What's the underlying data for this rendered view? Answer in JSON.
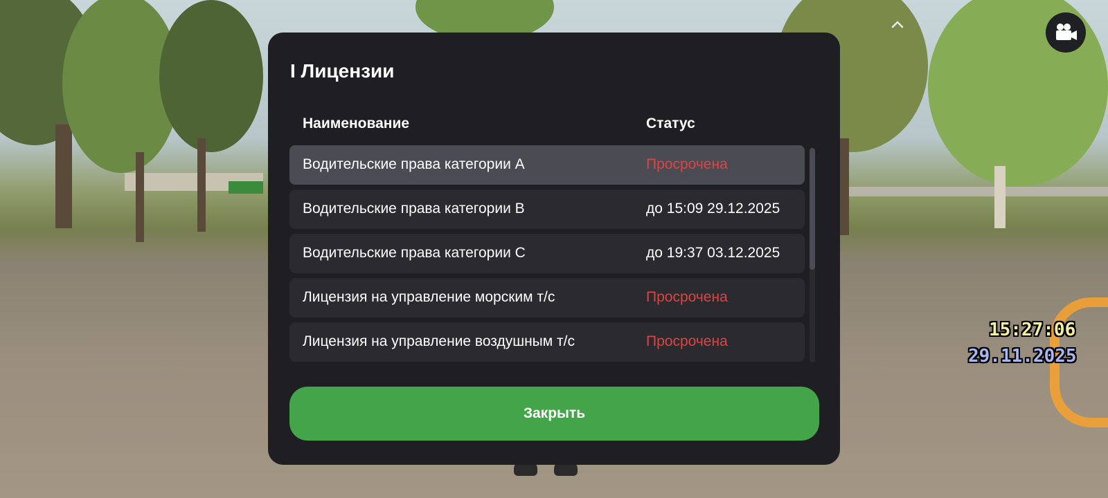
{
  "window": {
    "title": "I Лицензии"
  },
  "table": {
    "columns": [
      "Наименование",
      "Статус"
    ],
    "rows": [
      {
        "name": "Водительские права категории A",
        "status": "Просрочена",
        "expired": true,
        "selected": true
      },
      {
        "name": "Водительские права категории B",
        "status": "до 15:09 29.12.2025",
        "expired": false,
        "selected": false
      },
      {
        "name": "Водительские права категории C",
        "status": "до 19:37 03.12.2025",
        "expired": false,
        "selected": false
      },
      {
        "name": "Лицензия на управление морским т/с",
        "status": "Просрочена",
        "expired": true,
        "selected": false
      },
      {
        "name": "Лицензия на управление воздушным т/с",
        "status": "Просрочена",
        "expired": true,
        "selected": false
      }
    ]
  },
  "actions": {
    "close_label": "Закрыть"
  },
  "hud": {
    "time": "15:27:06",
    "date": "29.11.2025",
    "camera_icon": "video-camera-icon",
    "collapse_icon": "chevron-up-icon"
  },
  "colors": {
    "panel_bg": "#1f1f23",
    "row_bg": "#2a2a2f",
    "row_selected_bg": "#4b4b53",
    "expired_text": "#e04343",
    "close_button": "#43a449"
  }
}
